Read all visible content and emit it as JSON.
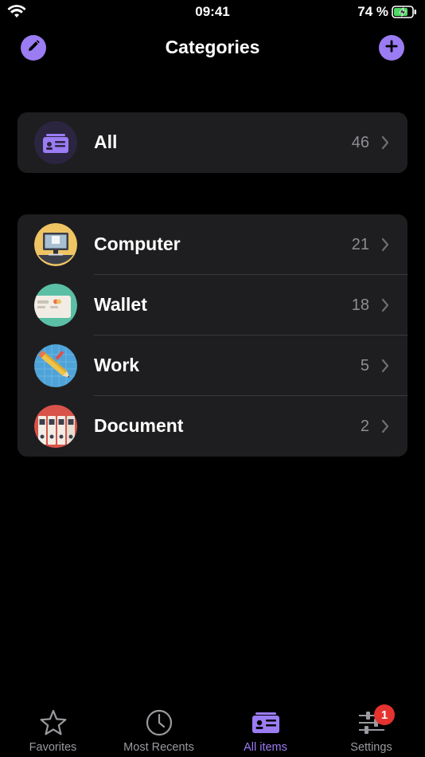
{
  "status_bar": {
    "time": "09:41",
    "battery": "74 %"
  },
  "navbar": {
    "title": "Categories"
  },
  "all_row": {
    "label": "All",
    "count": "46"
  },
  "categories": [
    {
      "label": "Computer",
      "count": "21"
    },
    {
      "label": "Wallet",
      "count": "18"
    },
    {
      "label": "Work",
      "count": "5"
    },
    {
      "label": "Document",
      "count": "2"
    }
  ],
  "tabbar": {
    "tabs": [
      {
        "label": "Favorites"
      },
      {
        "label": "Most Recents"
      },
      {
        "label": "All items"
      },
      {
        "label": "Settings",
        "badge": "1"
      }
    ],
    "active_tab": "All items"
  },
  "colors": {
    "accent": "#9b7cf3",
    "card": "#1e1e20",
    "badge": "#e5332f"
  },
  "icons": [
    "wifi-icon",
    "battery-icon",
    "pencil-icon",
    "plus-icon",
    "id-card-icon",
    "computer-icon",
    "wallet-icon",
    "work-icon",
    "document-icon",
    "chevron-right-icon",
    "star-icon",
    "clock-icon",
    "settings-sliders-icon"
  ]
}
